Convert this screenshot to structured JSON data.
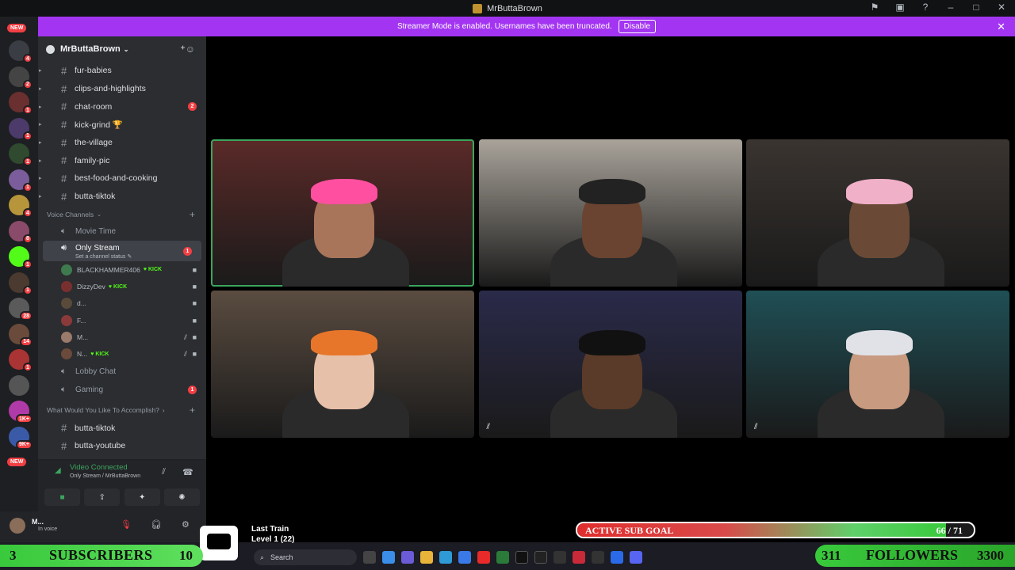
{
  "window": {
    "title": "MrButtaBrown"
  },
  "banner": {
    "text": "Streamer Mode is enabled. Usernames have been truncated.",
    "button": "Disable"
  },
  "guilds": [
    {
      "badge": "4",
      "color": "#3a3d44"
    },
    {
      "badge": "2",
      "color": "#444"
    },
    {
      "badge": "1",
      "color": "#6a2f2f"
    },
    {
      "badge": "1",
      "color": "#4b3a6a"
    },
    {
      "badge": "1",
      "color": "#2f4a2f"
    },
    {
      "badge": "1",
      "color": "#7a5d9a"
    },
    {
      "badge": "4",
      "color": "#b7953a"
    },
    {
      "badge": "8",
      "color": "#8a4a6a"
    },
    {
      "badge": "1",
      "color": "#53fc18"
    },
    {
      "badge": "1",
      "color": "#4a3a2f"
    },
    {
      "badge": "28",
      "color": "#5a5a5a"
    },
    {
      "badge": "14",
      "color": "#6a4a3a"
    },
    {
      "badge": "1",
      "color": "#a33"
    },
    {
      "badge": "",
      "color": "#555"
    },
    {
      "badge": "1K+",
      "color": "#b03aa8"
    },
    {
      "badge": "9K+",
      "color": "#3a5aa8"
    }
  ],
  "new_pill": "NEW",
  "server": {
    "name": "MrButtaBrown"
  },
  "text_channels": [
    {
      "name": "fur-babies",
      "badge": ""
    },
    {
      "name": "clips-and-highlights",
      "badge": ""
    },
    {
      "name": "chat-room",
      "badge": "2"
    },
    {
      "name": "kick-grind 🏆",
      "badge": ""
    },
    {
      "name": "the-village",
      "badge": ""
    },
    {
      "name": "family-pic",
      "badge": ""
    },
    {
      "name": "best-food-and-cooking",
      "badge": ""
    },
    {
      "name": "butta-tiktok",
      "badge": ""
    }
  ],
  "voice_category": "Voice Channels",
  "voice": {
    "movie": "Movie Time",
    "active": {
      "name": "Only Stream",
      "status": "Set a channel status",
      "badge": "1"
    },
    "users": [
      {
        "name": "BLACKHAMMER406",
        "kick": "KICK",
        "color": "#3f7a4f"
      },
      {
        "name": "DizzyDev",
        "kick": "KICK",
        "color": "#7a2f2f"
      },
      {
        "name": "d...",
        "kick": "",
        "color": "#5a4a3a"
      },
      {
        "name": "F...",
        "kick": "",
        "color": "#8a3a3a"
      },
      {
        "name": "M...",
        "kick": "",
        "color": "#9a7a6a"
      },
      {
        "name": "N...",
        "kick": "KICK",
        "color": "#6a4a3a"
      }
    ],
    "lobby": "Lobby Chat",
    "gaming": {
      "name": "Gaming",
      "badge": "1"
    }
  },
  "category2": "What Would You Like To Accomplish?",
  "channels2": [
    "butta-tiktok",
    "butta-youtube"
  ],
  "voice_panel": {
    "status": "Video Connected",
    "sub": "Only Stream / MrButtaBrown"
  },
  "user": {
    "name": "M...",
    "status": "In voice"
  },
  "tiles": [
    {
      "bg": "#5a2a28",
      "skin": "#a8745a",
      "hat": "#ff4fa0"
    },
    {
      "bg": "#a9a39a",
      "skin": "#6a4430",
      "hat": "#222"
    },
    {
      "bg": "#3a3430",
      "skin": "#6a4a36",
      "hat": "#f0b0c8"
    },
    {
      "bg": "#5a4c40",
      "skin": "#e6c0a8",
      "hat": "#e8762a"
    },
    {
      "bg": "#2a2a4a",
      "skin": "#5a3a28",
      "hat": "#111"
    },
    {
      "bg": "#1f4f55",
      "skin": "#c89a80",
      "hat": "#e0e2e8"
    }
  ],
  "music": {
    "line1": "Last Train",
    "line2": "Level 1  (22)"
  },
  "goal": {
    "label": "ACTIVE SUB GOAL",
    "count": "66 / 71",
    "progress": 0.93
  },
  "subscribers": {
    "count": "3",
    "label": "SUBSCRIBERS",
    "goal": "10"
  },
  "followers": {
    "count": "311",
    "label": "FOLLOWERS",
    "goal": "3300"
  },
  "taskbar": {
    "search": "Search"
  }
}
